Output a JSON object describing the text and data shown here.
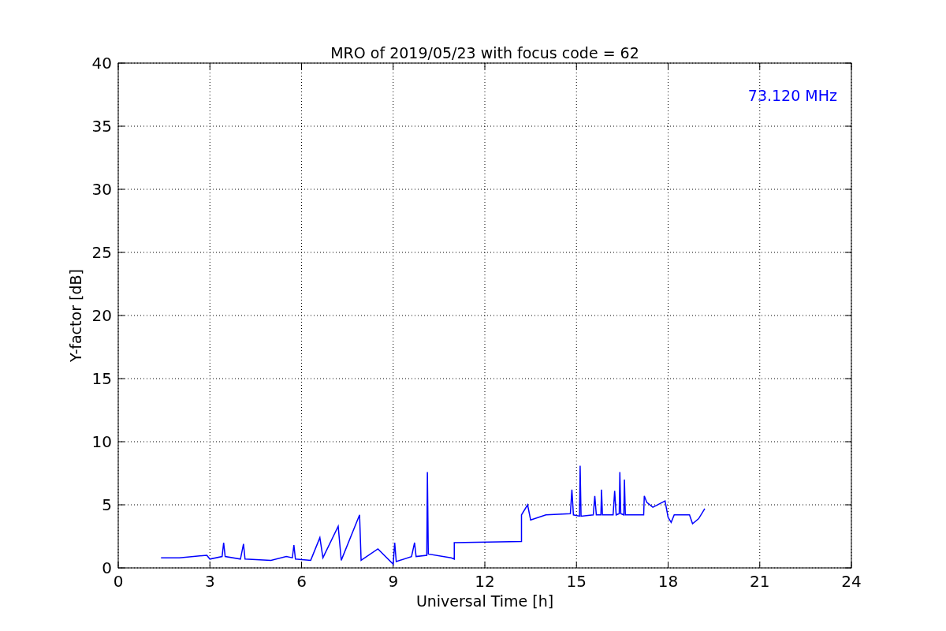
{
  "chart_data": {
    "type": "line",
    "title": "MRO of 2019/05/23 with focus code = 62",
    "xlabel": "Universal Time [h]",
    "ylabel": "Y-factor [dB]",
    "xlim": [
      0,
      24
    ],
    "ylim": [
      0,
      40
    ],
    "grid": true,
    "xticks": [
      0,
      3,
      6,
      9,
      12,
      15,
      18,
      21,
      24
    ],
    "yticks": [
      0,
      5,
      10,
      15,
      20,
      25,
      30,
      35,
      40
    ],
    "x": [
      1.4,
      2,
      2.9,
      3.0,
      3.4,
      3.45,
      3.5,
      4.0,
      4.1,
      4.15,
      5,
      5.5,
      5.7,
      5.75,
      5.8,
      6.3,
      6.6,
      6.7,
      7.2,
      7.3,
      7.9,
      7.95,
      8.5,
      9.0,
      9.05,
      9.1,
      9.6,
      9.7,
      9.75,
      10.1,
      10.12,
      10.15,
      10.9,
      11.0,
      11.0,
      13.2,
      13.2,
      13.4,
      13.5,
      14.0,
      14.8,
      14.85,
      14.9,
      15.1,
      15.12,
      15.15,
      15.55,
      15.6,
      15.65,
      15.8,
      15.82,
      15.85,
      16.2,
      16.25,
      16.3,
      16.4,
      16.42,
      16.45,
      16.55,
      16.57,
      16.6,
      17.2,
      17.22,
      17.3,
      17.5,
      17.9,
      18.0,
      18.1,
      18.2,
      18.7,
      18.8,
      19.0,
      19.2
    ],
    "series": [
      {
        "name": "73.120 MHz",
        "color": "#0000ff",
        "values": [
          0.8,
          0.8,
          1.0,
          0.7,
          0.9,
          2.0,
          0.9,
          0.7,
          1.9,
          0.7,
          0.6,
          0.9,
          0.8,
          1.8,
          0.7,
          0.6,
          2.4,
          0.8,
          3.3,
          0.6,
          4.2,
          0.6,
          1.5,
          0.3,
          2.0,
          0.5,
          0.9,
          2.0,
          0.9,
          1.0,
          7.6,
          1.1,
          0.8,
          0.7,
          2.0,
          2.1,
          4.2,
          5.0,
          3.8,
          4.2,
          4.3,
          6.2,
          4.2,
          4.1,
          8.1,
          4.1,
          4.2,
          5.7,
          4.2,
          4.2,
          6.2,
          4.2,
          4.2,
          6.1,
          4.2,
          4.3,
          7.6,
          4.3,
          4.2,
          7.0,
          4.2,
          4.2,
          5.7,
          5.2,
          4.8,
          5.3,
          4.0,
          3.6,
          4.2,
          4.2,
          3.5,
          3.9,
          4.7
        ]
      }
    ]
  }
}
